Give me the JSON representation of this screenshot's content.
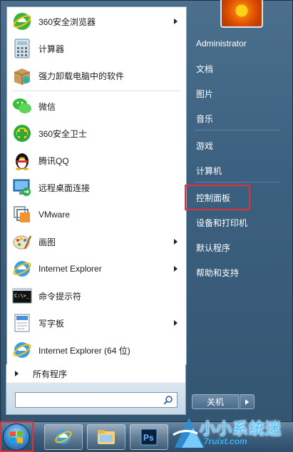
{
  "left_items": [
    {
      "label": "360安全浏览器",
      "icon": "360-browser-icon",
      "arrow": true
    },
    {
      "label": "计算器",
      "icon": "calculator-icon",
      "arrow": false
    },
    {
      "label": "强力卸载电脑中的软件",
      "icon": "uninstall-box-icon",
      "arrow": false
    },
    {
      "label": "微信",
      "icon": "wechat-icon",
      "arrow": false
    },
    {
      "label": "360安全卫士",
      "icon": "360-guard-icon",
      "arrow": false
    },
    {
      "label": "腾讯QQ",
      "icon": "qq-penguin-icon",
      "arrow": false
    },
    {
      "label": "远程桌面连接",
      "icon": "remote-desktop-icon",
      "arrow": false
    },
    {
      "label": "VMware",
      "icon": "vmware-icon",
      "arrow": false
    },
    {
      "label": "画图",
      "icon": "paint-icon",
      "arrow": true
    },
    {
      "label": "Internet Explorer",
      "icon": "ie-icon",
      "arrow": true
    },
    {
      "label": "命令提示符",
      "icon": "cmd-icon",
      "arrow": false
    },
    {
      "label": "写字板",
      "icon": "wordpad-icon",
      "arrow": true
    },
    {
      "label": "Internet Explorer (64 位)",
      "icon": "ie-icon",
      "arrow": false
    }
  ],
  "all_programs": "所有程序",
  "search": {
    "placeholder": ""
  },
  "right_links": [
    {
      "label": "Administrator",
      "name": "user-administrator"
    },
    {
      "label": "文档",
      "name": "documents-link"
    },
    {
      "label": "图片",
      "name": "pictures-link"
    },
    {
      "label": "音乐",
      "name": "music-link"
    },
    {
      "label": "游戏",
      "name": "games-link"
    },
    {
      "label": "计算机",
      "name": "computer-link"
    },
    {
      "label": "控制面板",
      "name": "control-panel-link"
    },
    {
      "label": "设备和打印机",
      "name": "devices-printers-link"
    },
    {
      "label": "默认程序",
      "name": "default-programs-link"
    },
    {
      "label": "帮助和支持",
      "name": "help-support-link"
    }
  ],
  "shutdown_label": "关机",
  "watermark": {
    "text": "小小系统迷",
    "url": "7ruixt.com"
  },
  "colors": {
    "highlight": "#e0303a",
    "menu_blue": "#3c6180"
  }
}
